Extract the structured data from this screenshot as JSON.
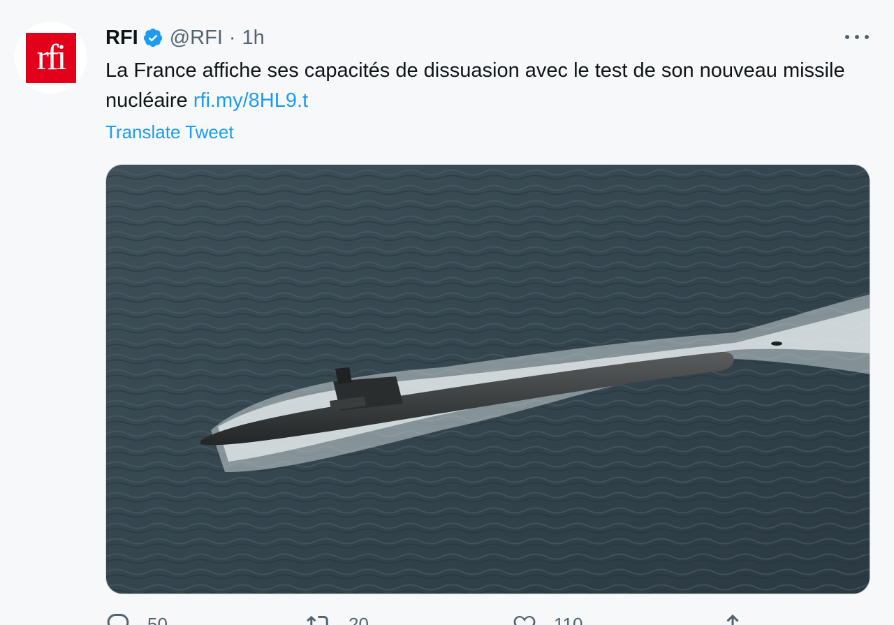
{
  "tweet": {
    "author_name": "RFI",
    "author_handle": "@RFI",
    "separator": "·",
    "time": "1h",
    "avatar_text": "rfi",
    "text_before_link": "La France affiche ses capacités de dissuasion avec le test de son nouveau missile nucléaire ",
    "link_text": "rfi.my/8HL9.t",
    "translate_label": "Translate Tweet"
  },
  "actions": {
    "reply_count": "50",
    "retweet_count": "20",
    "like_count": "110"
  },
  "colors": {
    "accent": "#1d9bf0",
    "rfi_red": "#e2001a",
    "muted_text": "#536471",
    "background": "#f7f8f9"
  }
}
